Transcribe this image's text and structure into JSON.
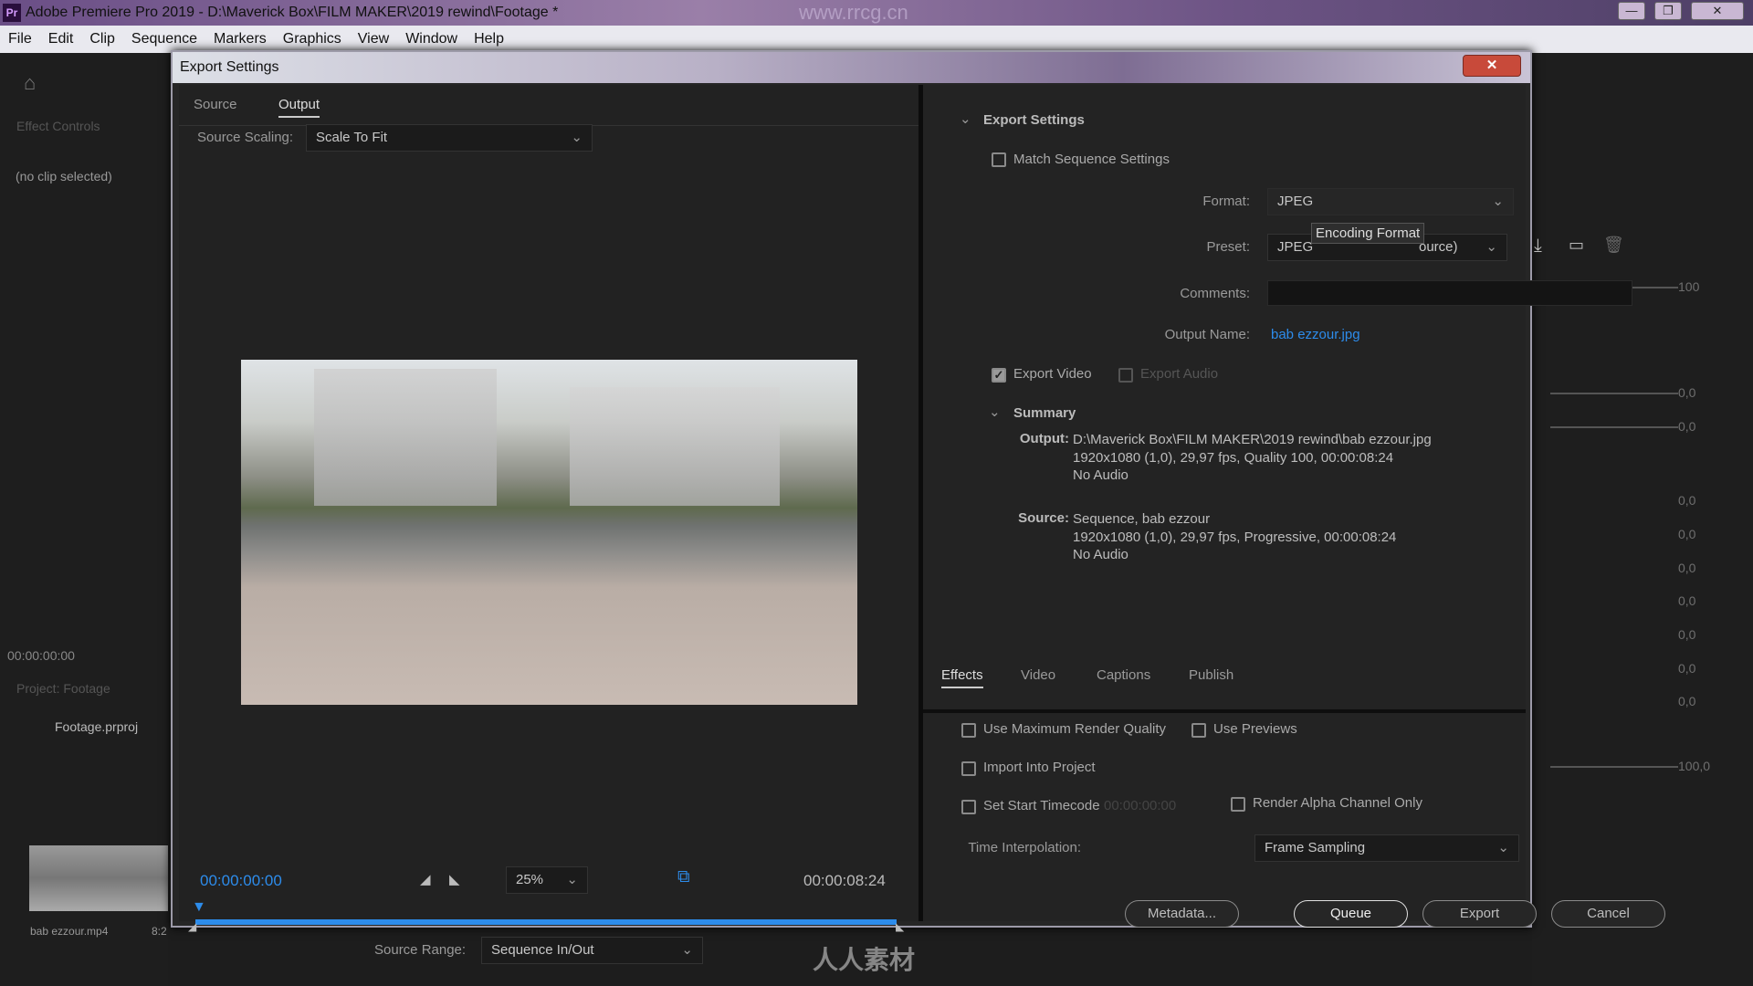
{
  "app": {
    "title": "Adobe Premiere Pro 2019 - D:\\Maverick Box\\FILM MAKER\\2019 rewind\\Footage *",
    "logo": "Pr",
    "watermark": "www.rrcg.cn",
    "footer_logo": "人人素材"
  },
  "menu": [
    "File",
    "Edit",
    "Clip",
    "Sequence",
    "Markers",
    "Graphics",
    "View",
    "Window",
    "Help"
  ],
  "background": {
    "effect_controls": "Effect Controls",
    "no_clip": "(no clip selected)",
    "timecode": "00:00:00:00",
    "project": "Project: Footage",
    "project_file": "Footage.prproj",
    "clip_name": "bab ezzour.mp4",
    "clip_dur": "8:2",
    "right_values": [
      "100",
      "0,0",
      "0,0",
      "0,0",
      "0,0",
      "0,0",
      "0,0",
      "0,0",
      "0,0",
      "0,0",
      "100,0"
    ]
  },
  "dialog": {
    "title": "Export Settings",
    "close": "✕",
    "left": {
      "tabs": [
        {
          "label": "Source",
          "active": false
        },
        {
          "label": "Output",
          "active": true
        }
      ],
      "source_scaling_label": "Source Scaling:",
      "source_scaling": "Scale To Fit",
      "current_time": "00:00:00:00",
      "duration": "00:00:08:24",
      "zoom": "25%",
      "source_range_label": "Source Range:",
      "source_range": "Sequence In/Out",
      "accent": "#2d8ceb"
    },
    "export_settings": {
      "header": "Export Settings",
      "match_sequence": {
        "label": "Match Sequence Settings",
        "checked": false
      },
      "format_label": "Format:",
      "format": "JPEG",
      "tooltip": "Encoding Format",
      "preset_label": "Preset:",
      "preset": "JPEG",
      "preset_tail": "ource)",
      "comments_label": "Comments:",
      "comments": "",
      "output_name_label": "Output Name:",
      "output_name": "bab ezzour.jpg",
      "export_video": {
        "label": "Export Video",
        "checked": true
      },
      "export_audio": {
        "label": "Export Audio",
        "checked": false
      },
      "summary": {
        "header": "Summary",
        "output_label": "Output:",
        "output_lines": [
          "D:\\Maverick Box\\FILM MAKER\\2019 rewind\\bab ezzour.jpg",
          "1920x1080 (1,0), 29,97 fps, Quality 100, 00:00:08:24",
          "No Audio"
        ],
        "source_label": "Source:",
        "source_lines": [
          "Sequence, bab ezzour",
          "1920x1080 (1,0), 29,97 fps, Progressive, 00:00:08:24",
          "No Audio"
        ]
      }
    },
    "tabs": [
      {
        "label": "Effects",
        "active": true
      },
      {
        "label": "Video",
        "active": false
      },
      {
        "label": "Captions",
        "active": false
      },
      {
        "label": "Publish",
        "active": false
      }
    ],
    "options": {
      "max_quality": "Use Maximum Render Quality",
      "use_previews": "Use Previews",
      "import_project": "Import Into Project",
      "start_timecode": "Set Start Timecode",
      "start_timecode_value": "00:00:00:00",
      "alpha_only": "Render Alpha Channel Only",
      "time_interp_label": "Time Interpolation:",
      "time_interp": "Frame Sampling"
    },
    "buttons": {
      "metadata": "Metadata...",
      "queue": "Queue",
      "export": "Export",
      "cancel": "Cancel"
    }
  }
}
